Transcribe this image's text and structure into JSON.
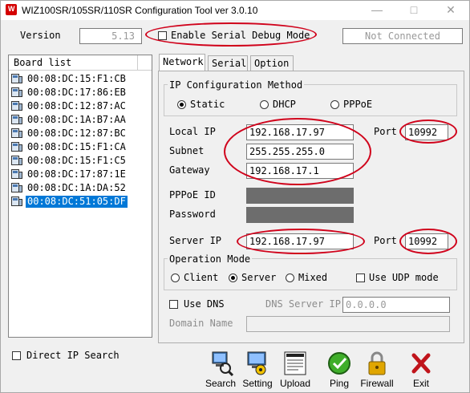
{
  "window": {
    "title": "WIZ100SR/105SR/110SR Configuration Tool ver 3.0.10",
    "minimize": "—",
    "maximize": "□",
    "close": "✕"
  },
  "header": {
    "version_label": "Version",
    "version_value": "5.13",
    "debug_label": "Enable Serial Debug Mode",
    "status": "Not Connected"
  },
  "board_list": {
    "header": "Board list",
    "items": [
      "00:08:DC:15:F1:CB",
      "00:08:DC:17:86:EB",
      "00:08:DC:12:87:AC",
      "00:08:DC:1A:B7:AA",
      "00:08:DC:12:87:BC",
      "00:08:DC:15:F1:CA",
      "00:08:DC:15:F1:C5",
      "00:08:DC:17:87:1E",
      "00:08:DC:1A:DA:52",
      "00:08:DC:51:05:DF"
    ],
    "selected_index": 9
  },
  "direct_ip_search": "Direct IP Search",
  "tabs": [
    "Network",
    "Serial",
    "Option"
  ],
  "network": {
    "ip_method_label": "IP Configuration Method",
    "ip_methods": [
      "Static",
      "DHCP",
      "PPPoE"
    ],
    "selected_method": "Static",
    "local_ip_label": "Local IP",
    "local_ip": "192.168.17.97",
    "port_label": "Port",
    "local_port": "10992",
    "subnet_label": "Subnet",
    "subnet": "255.255.255.0",
    "gateway_label": "Gateway",
    "gateway": "192.168.17.1",
    "pppoe_id_label": "PPPoE ID",
    "password_label": "Password",
    "server_ip_label": "Server IP",
    "server_ip": "192.168.17.97",
    "server_port_label": "Port",
    "server_port": "10992",
    "op_mode_label": "Operation Mode",
    "op_modes": [
      "Client",
      "Server",
      "Mixed"
    ],
    "selected_op_mode": "Server",
    "use_udp_label": "Use UDP mode",
    "use_dns_label": "Use DNS",
    "dns_server_label": "DNS Server IP",
    "dns_server_ip": "0.0.0.0",
    "domain_name_label": "Domain Name",
    "domain_name": ""
  },
  "toolbar": {
    "search": "Search",
    "setting": "Setting",
    "upload": "Upload",
    "ping": "Ping",
    "firewall": "Firewall",
    "exit": "Exit"
  },
  "colors": {
    "highlight_ellipse": "#d0021b",
    "selection": "#0078d7",
    "title_icon": "#d40000"
  }
}
